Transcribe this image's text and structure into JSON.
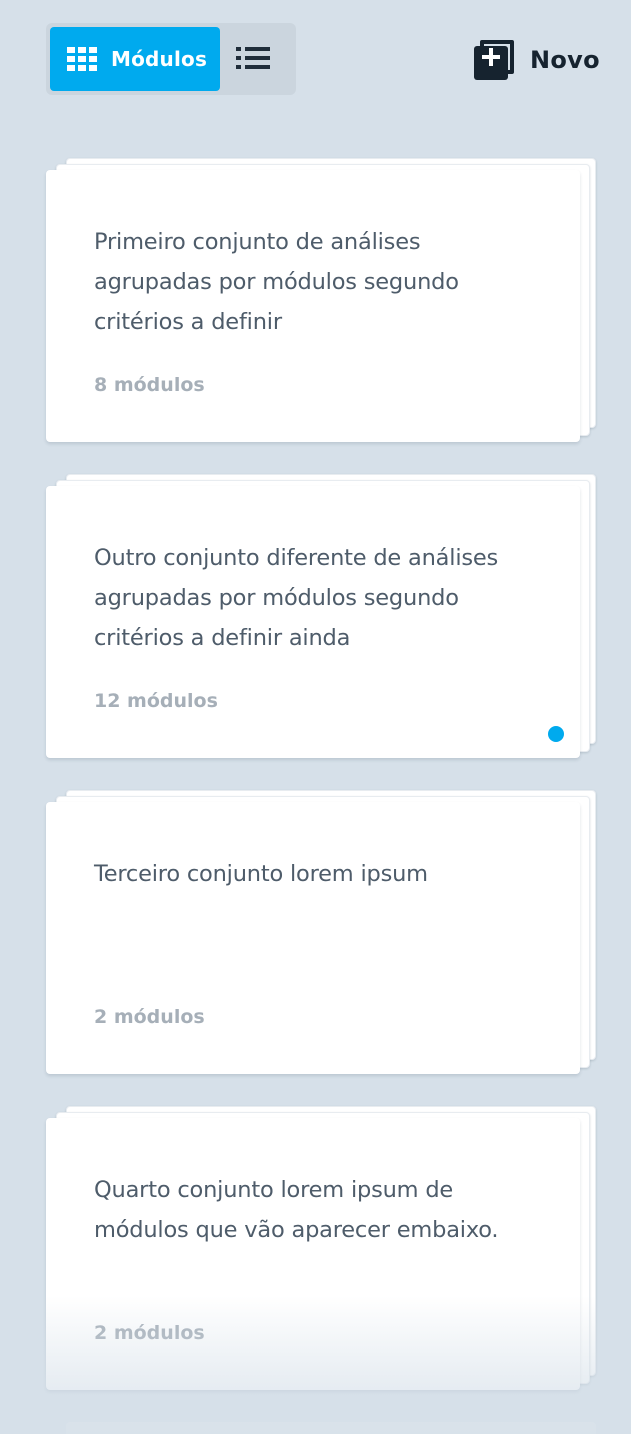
{
  "toolbar": {
    "view_toggle": {
      "grid_label": "Módulos",
      "grid_icon": "grid-icon",
      "list_icon": "list-icon",
      "active": "grid"
    },
    "new_button": {
      "label": "Novo",
      "icon": "add-stack-icon"
    }
  },
  "colors": {
    "background": "#d6e0e9",
    "accent": "#00aaee",
    "dark": "#16232f",
    "text": "#4e5c6a",
    "muted": "#a6afb8"
  },
  "cards": [
    {
      "title": "Primeiro conjunto de análises agrupadas por módulos segundo critérios a definir",
      "count": "8 módulos",
      "unread": false
    },
    {
      "title": "Outro conjunto  diferente de análises agrupadas por módulos segundo critérios a definir ainda",
      "count": "12 módulos",
      "unread": true
    },
    {
      "title": "Terceiro conjunto lorem ipsum",
      "count": "2 módulos",
      "unread": false
    },
    {
      "title": "Quarto conjunto lorem ipsum de módulos que vão aparecer embaixo.",
      "count": "2 módulos",
      "unread": false
    }
  ]
}
